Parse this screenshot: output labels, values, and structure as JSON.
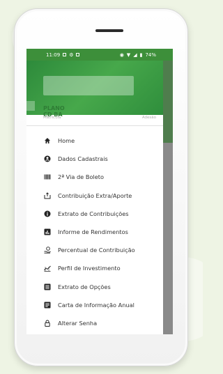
{
  "status_bar": {
    "time": "11:09",
    "battery": "74%"
  },
  "drawer": {
    "plan_name": "PLANO CD BA",
    "matricula_label": "Matrícula",
    "adesao_label": "Adesão",
    "menu": [
      {
        "label": "Home",
        "icon": "home-icon"
      },
      {
        "label": "Dados Cadastrais",
        "icon": "account-circle-icon"
      },
      {
        "label": "2ª Via de Boleto",
        "icon": "barcode-icon"
      },
      {
        "label": "Contribuição Extra/Aporte",
        "icon": "upload-money-icon"
      },
      {
        "label": "Extrato de Contribuições",
        "icon": "info-icon"
      },
      {
        "label": "Informe de Rendimentos",
        "icon": "chart-box-icon"
      },
      {
        "label": "Percentual de Contribuição",
        "icon": "hand-coin-icon"
      },
      {
        "label": "Perfil de Investimento",
        "icon": "trend-icon"
      },
      {
        "label": "Extrato de Opções",
        "icon": "list-box-icon"
      },
      {
        "label": "Carta de Informação Anual",
        "icon": "document-icon"
      },
      {
        "label": "Alterar Senha",
        "icon": "lock-icon"
      }
    ]
  },
  "colors": {
    "brand_green": "#3d8f3a",
    "plan_text": "#2f7d35"
  }
}
